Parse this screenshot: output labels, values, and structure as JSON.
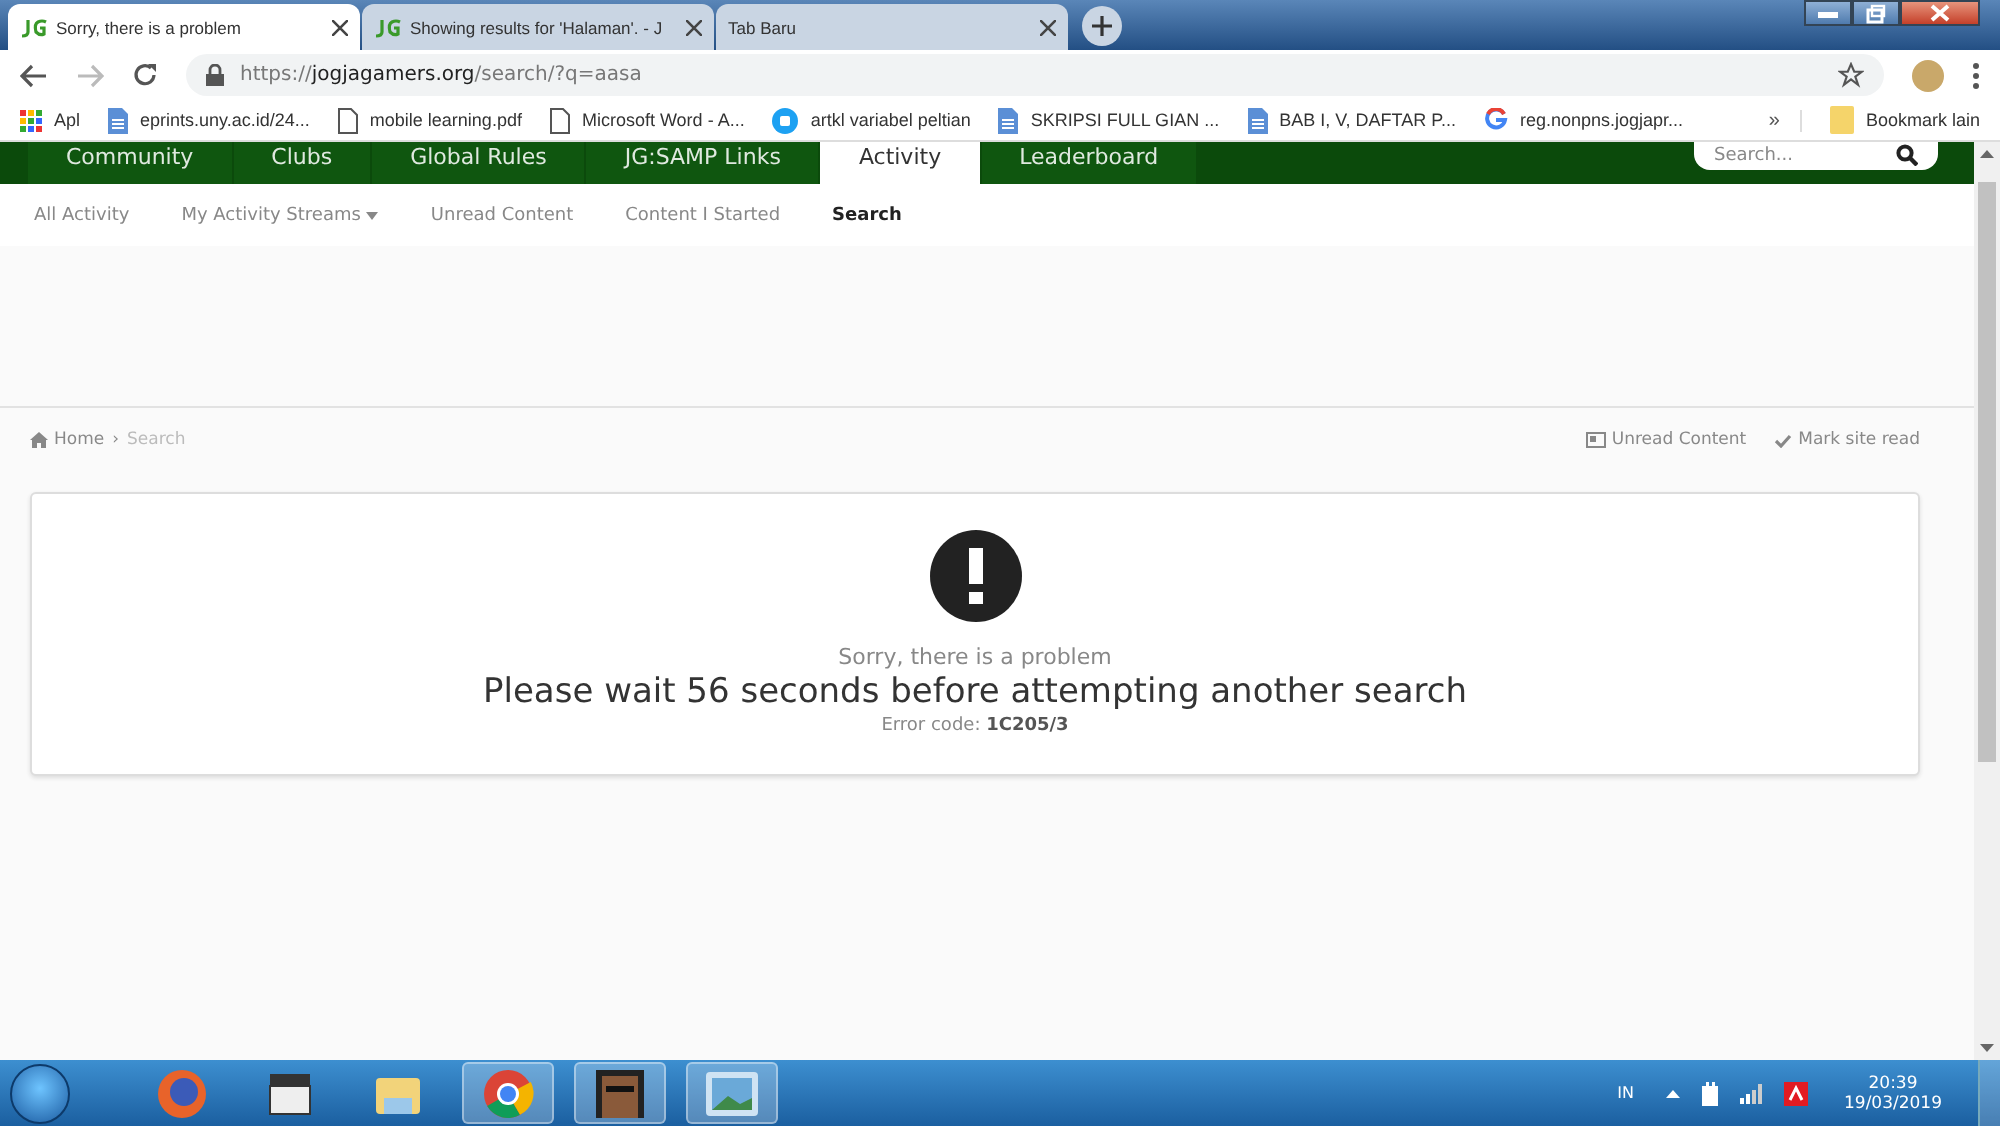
{
  "browser": {
    "tabs": [
      {
        "title": "Sorry, there is a problem",
        "favicon": true,
        "selected": true
      },
      {
        "title": "Showing results for 'Halaman'. - J",
        "favicon": true,
        "selected": false
      },
      {
        "title": "Tab Baru",
        "favicon": false,
        "selected": false
      }
    ],
    "address": {
      "scheme": "https://",
      "host": "jogjagamers.org",
      "path": "/search/?q=aasa"
    },
    "bookmarks": [
      {
        "label": "Apl",
        "kind": "apps"
      },
      {
        "label": "eprints.uny.ac.id/24...",
        "kind": "doc"
      },
      {
        "label": "mobile learning.pdf",
        "kind": "page"
      },
      {
        "label": "Microsoft Word - A...",
        "kind": "page"
      },
      {
        "label": "artkl variabel peltian",
        "kind": "round"
      },
      {
        "label": "SKRIPSI FULL GIAN ...",
        "kind": "doc"
      },
      {
        "label": "BAB I, V, DAFTAR P...",
        "kind": "doc"
      },
      {
        "label": "reg.nonpns.jogjapr...",
        "kind": "google"
      }
    ],
    "more": "»",
    "other_bookmarks": "Bookmark lain"
  },
  "nav": {
    "items": [
      {
        "label": "Community",
        "selected": false
      },
      {
        "label": "Clubs",
        "selected": false
      },
      {
        "label": "Global Rules",
        "selected": false
      },
      {
        "label": "JG:SAMP Links",
        "selected": false
      },
      {
        "label": "Activity",
        "selected": true
      },
      {
        "label": "Leaderboard",
        "selected": false
      }
    ],
    "search": {
      "placeholder": "Search..."
    }
  },
  "subnav": [
    {
      "label": "All Activity",
      "selected": false,
      "has_menu": false
    },
    {
      "label": "My Activity Streams",
      "selected": false,
      "has_menu": true
    },
    {
      "label": "Unread Content",
      "selected": false,
      "has_menu": false
    },
    {
      "label": "Content I Started",
      "selected": false,
      "has_menu": false
    },
    {
      "label": "Search",
      "selected": true,
      "has_menu": false
    }
  ],
  "breadcrumb": {
    "home": "Home",
    "separator": "›",
    "current": "Search"
  },
  "page_actions": [
    "Unread Content",
    "Mark site read"
  ],
  "error": {
    "title": "Sorry, there is a problem",
    "message": "Please wait 56 seconds before attempting another search",
    "code_label": "Error code:",
    "code": "1C205/3"
  },
  "taskbar": {
    "language": "IN",
    "time": "20:39",
    "date": "19/03/2019"
  }
}
